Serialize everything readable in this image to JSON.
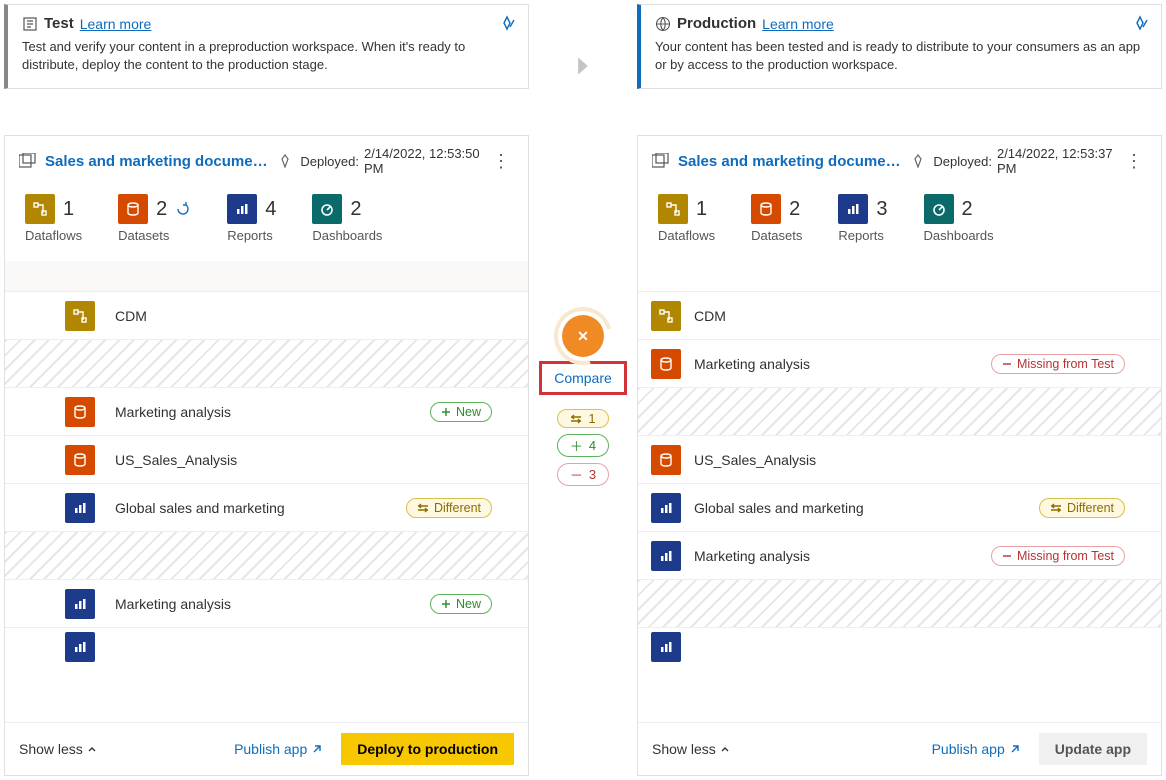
{
  "stages": {
    "test": {
      "title": "Test",
      "learn": "Learn more",
      "desc": "Test and verify your content in a preproduction workspace. When it's ready to distribute, deploy the content to the production stage."
    },
    "prod": {
      "title": "Production",
      "learn": "Learn more",
      "desc": "Your content has been tested and is ready to distribute to your consumers as an app or by access to the production workspace."
    }
  },
  "workspaces": {
    "test": {
      "name": "Sales and marketing documentati...",
      "deployed_label": "Deployed:",
      "deployed_at": "2/14/2022, 12:53:50 PM",
      "stats": {
        "dataflows": {
          "n": "1",
          "label": "Dataflows"
        },
        "datasets": {
          "n": "2",
          "label": "Datasets"
        },
        "reports": {
          "n": "4",
          "label": "Reports"
        },
        "dashboards": {
          "n": "2",
          "label": "Dashboards"
        }
      },
      "items": [
        {
          "type": "dataflow",
          "name": "CDM",
          "badge": null
        },
        {
          "type": "hatch"
        },
        {
          "type": "dataset",
          "name": "Marketing analysis",
          "badge": "new"
        },
        {
          "type": "dataset",
          "name": "US_Sales_Analysis",
          "badge": null
        },
        {
          "type": "report",
          "name": "Global sales and marketing",
          "badge": "diff"
        },
        {
          "type": "hatch"
        },
        {
          "type": "report",
          "name": "Marketing analysis",
          "badge": "new"
        },
        {
          "type": "report-partial"
        }
      ],
      "show_less": "Show less",
      "publish": "Publish app",
      "primary": "Deploy to production"
    },
    "prod": {
      "name": "Sales and marketing documentati...",
      "deployed_label": "Deployed:",
      "deployed_at": "2/14/2022, 12:53:37 PM",
      "stats": {
        "dataflows": {
          "n": "1",
          "label": "Dataflows"
        },
        "datasets": {
          "n": "2",
          "label": "Datasets"
        },
        "reports": {
          "n": "3",
          "label": "Reports"
        },
        "dashboards": {
          "n": "2",
          "label": "Dashboards"
        }
      },
      "items": [
        {
          "type": "dataflow",
          "name": "CDM",
          "badge": null
        },
        {
          "type": "dataset",
          "name": "Marketing analysis",
          "badge": "miss"
        },
        {
          "type": "hatch"
        },
        {
          "type": "dataset",
          "name": "US_Sales_Analysis",
          "badge": null
        },
        {
          "type": "report",
          "name": "Global sales and marketing",
          "badge": "diff"
        },
        {
          "type": "report",
          "name": "Marketing analysis",
          "badge": "miss"
        },
        {
          "type": "hatch"
        },
        {
          "type": "report-partial"
        }
      ],
      "show_less": "Show less",
      "publish": "Publish app",
      "primary": "Update app"
    }
  },
  "compare": {
    "label": "Compare",
    "diff": "1",
    "add": "4",
    "del": "3"
  },
  "badges": {
    "new": "New",
    "diff": "Different",
    "miss": "Missing from Test"
  }
}
